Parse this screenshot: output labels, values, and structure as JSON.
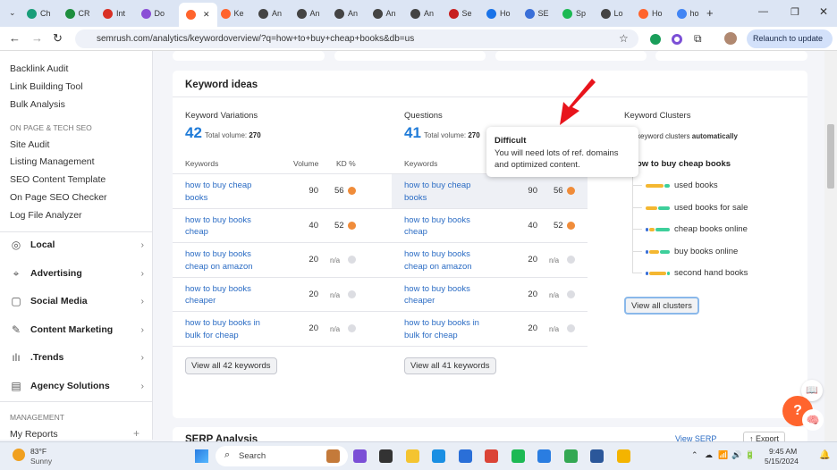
{
  "browser": {
    "tabs": [
      "Ch",
      "CR",
      "Int",
      "Do",
      "",
      "Ke",
      "An",
      "An",
      "An",
      "An",
      "An",
      "Se",
      "Ho",
      "SE",
      "Sp",
      "Lo",
      "Ho",
      "ho"
    ],
    "url": "semrush.com/analytics/keywordoverview/?q=how+to+buy+cheap+books&db=us",
    "relaunch": "Relaunch to update"
  },
  "sidebar": {
    "top_items": [
      "Backlink Audit",
      "Link Building Tool",
      "Bulk Analysis"
    ],
    "section1": "ON PAGE & TECH SEO",
    "section1_items": [
      "Site Audit",
      "Listing Management",
      "SEO Content Template",
      "On Page SEO Checker",
      "Log File Analyzer"
    ],
    "groups": [
      {
        "label": "Local",
        "icon": "location-pin-icon"
      },
      {
        "label": "Advertising",
        "icon": "target-icon"
      },
      {
        "label": "Social Media",
        "icon": "chat-icon"
      },
      {
        "label": "Content Marketing",
        "icon": "pencil-icon"
      },
      {
        "label": ".Trends",
        "icon": "bars-icon"
      },
      {
        "label": "Agency Solutions",
        "icon": "document-icon"
      }
    ],
    "section2": "MANAGEMENT",
    "my_reports": "My Reports"
  },
  "keyword_ideas": {
    "title": "Keyword ideas",
    "variations": {
      "title": "Keyword Variations",
      "count": "42",
      "total_label": "Total volume:",
      "total": "270",
      "col_keywords": "Keywords",
      "col_volume": "Volume",
      "col_kd": "KD %",
      "rows": [
        {
          "kw": "how to buy cheap books",
          "vol": "90",
          "kd": "56",
          "color": "#f08c3a"
        },
        {
          "kw": "how to buy books cheap",
          "vol": "40",
          "kd": "52",
          "color": "#f08c3a"
        },
        {
          "kw": "how to buy books cheap on amazon",
          "vol": "20",
          "kd": "n/a",
          "color": "#dcdde2"
        },
        {
          "kw": "how to buy books cheaper",
          "vol": "20",
          "kd": "n/a",
          "color": "#dcdde2"
        },
        {
          "kw": "how to buy books in bulk for cheap",
          "vol": "20",
          "kd": "n/a",
          "color": "#dcdde2"
        }
      ],
      "button": "View all 42 keywords"
    },
    "questions": {
      "title": "Questions",
      "count": "41",
      "total_label": "Total volume:",
      "total": "270",
      "col_keywords": "Keywords",
      "rows": [
        {
          "kw": "how to buy cheap books",
          "vol": "90",
          "kd": "56",
          "color": "#f08c3a"
        },
        {
          "kw": "how to buy books cheap",
          "vol": "40",
          "kd": "52",
          "color": "#f08c3a"
        },
        {
          "kw": "how to buy books cheap on amazon",
          "vol": "20",
          "kd": "n/a",
          "color": "#dcdde2"
        },
        {
          "kw": "how to buy books cheaper",
          "vol": "20",
          "kd": "n/a",
          "color": "#dcdde2"
        },
        {
          "kw": "how to buy books in bulk for cheap",
          "vol": "20",
          "kd": "n/a",
          "color": "#dcdde2"
        }
      ],
      "button": "View all 41 keywords"
    },
    "clusters": {
      "title": "Keyword Clusters",
      "subtitle_pre": "keyword clusters ",
      "subtitle_bold": "automatically",
      "root": "ow to buy cheap books",
      "items": [
        "used books",
        "used books for sale",
        "cheap books online",
        "buy books online",
        "second hand books"
      ],
      "button": "View all clusters"
    }
  },
  "tooltip": {
    "title": "Difficult",
    "text": "You will need lots of ref. domains and optimized content."
  },
  "serp": {
    "title": "SERP Analysis",
    "view": "View SERP",
    "export": "Export"
  },
  "taskbar": {
    "temp": "83°F",
    "weather": "Sunny",
    "search": "Search",
    "time": "9:45 AM",
    "date": "5/15/2024"
  }
}
